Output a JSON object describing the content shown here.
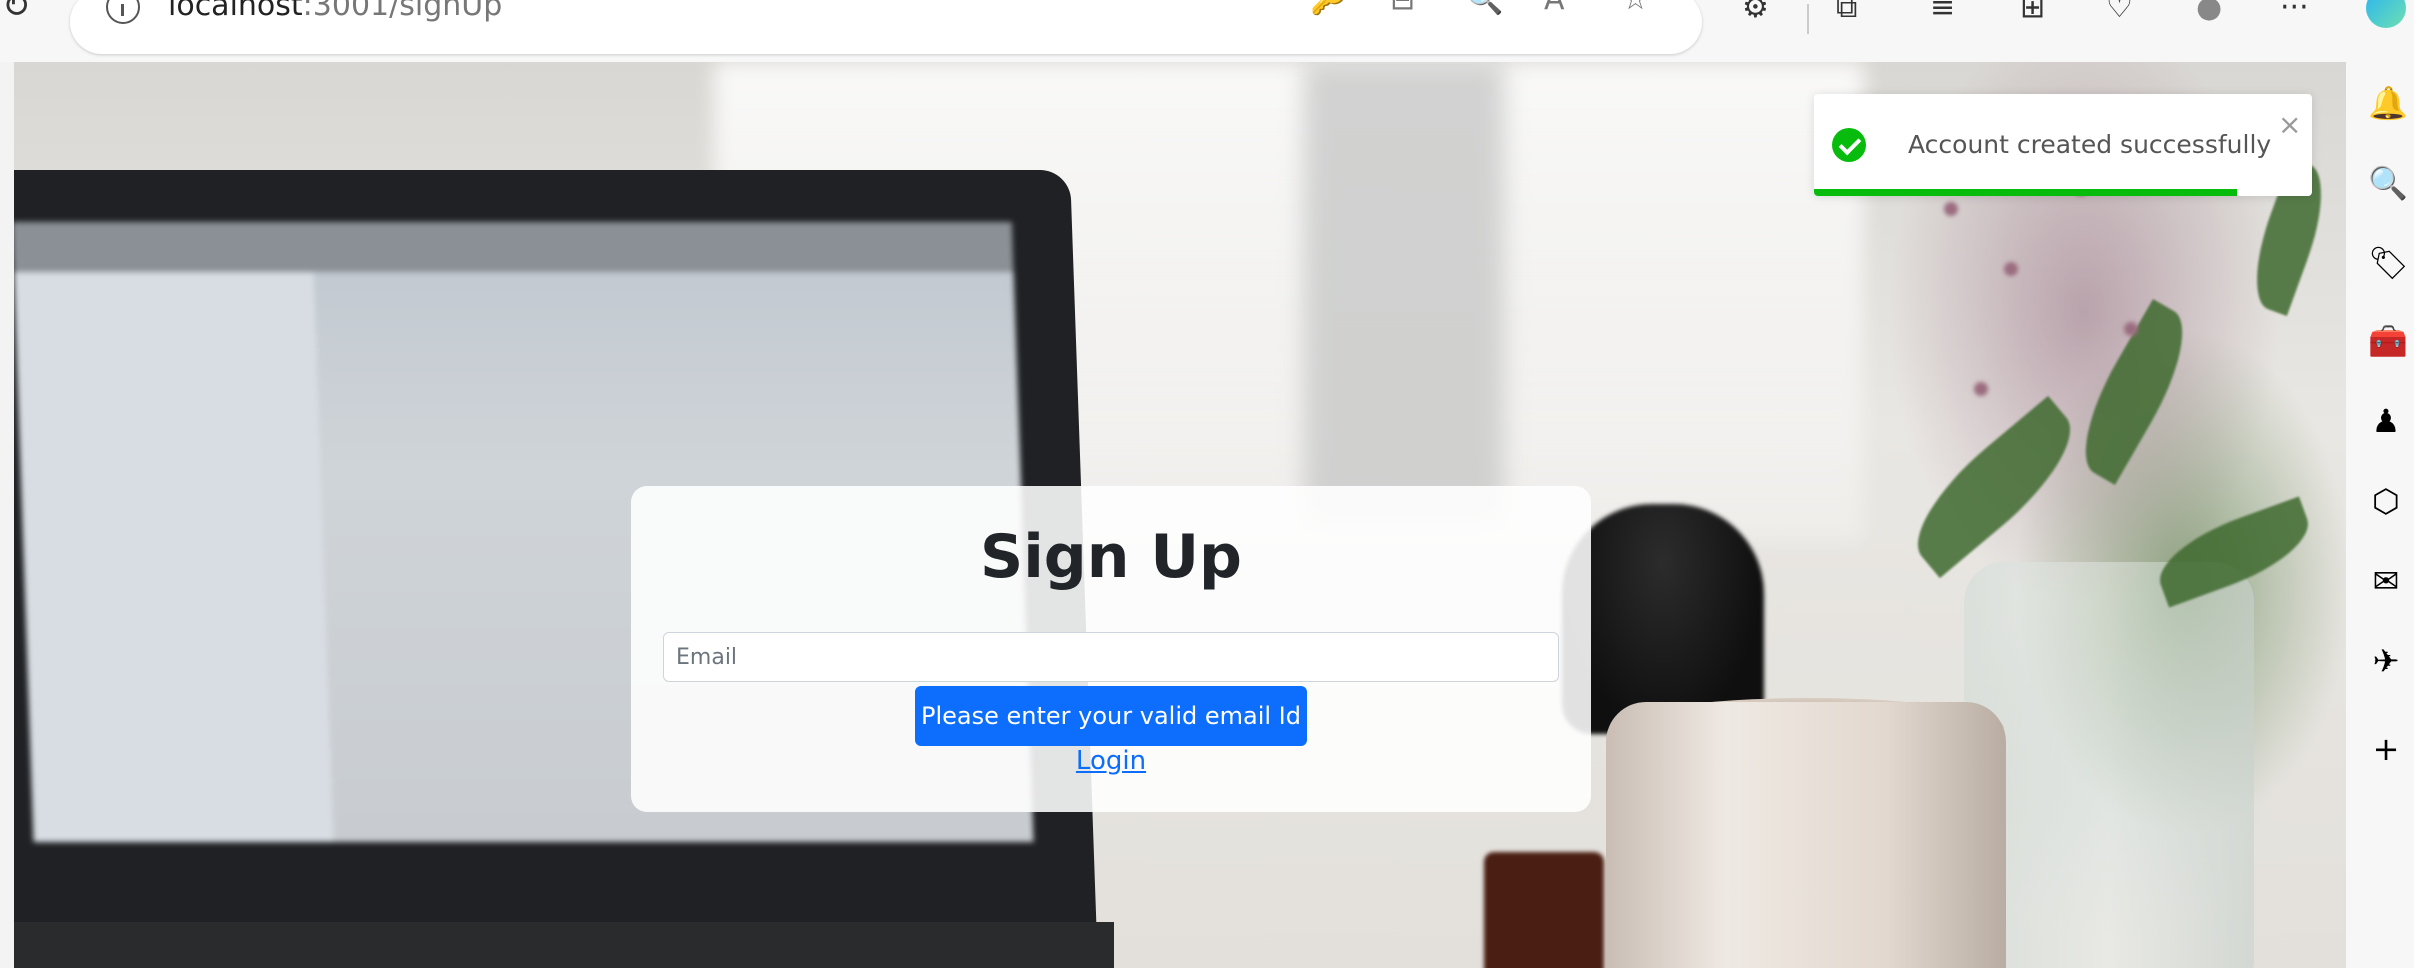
{
  "browser": {
    "url": {
      "host": "localhost",
      "path": ":3001/signUp"
    },
    "address_icons": {
      "key": "🔑",
      "split": "⊟",
      "zoom": "🔍",
      "read_aloud": "A",
      "favorite": "☆"
    },
    "toolbar_icons": {
      "extensions": "⚙",
      "split_screen": "⧉",
      "favorites": "≡",
      "collections": "⊞",
      "performance": "♡",
      "profile": "●",
      "more": "···"
    }
  },
  "signup": {
    "title": "Sign Up",
    "email_placeholder": "Email",
    "email_value": "",
    "submit_label": "Please enter your valid email Id",
    "login_link": "Login"
  },
  "toast": {
    "message": "Account created successfully",
    "close": "×",
    "progress_percent": 85,
    "color": "#07bc0c"
  },
  "edge_sidebar": {
    "icons": [
      {
        "name": "bell-icon",
        "glyph": "🔔"
      },
      {
        "name": "search-icon",
        "glyph": "🔍"
      },
      {
        "name": "tag-icon",
        "glyph": "🏷"
      },
      {
        "name": "toolbox-icon",
        "glyph": "🧰"
      },
      {
        "name": "games-icon",
        "glyph": "♟"
      },
      {
        "name": "office-icon",
        "glyph": "⬡"
      },
      {
        "name": "outlook-icon",
        "glyph": "✉"
      },
      {
        "name": "send-icon",
        "glyph": "✈"
      },
      {
        "name": "add-icon",
        "glyph": "+"
      }
    ]
  },
  "colors": {
    "primary": "#0d6efd",
    "success": "#07bc0c"
  }
}
